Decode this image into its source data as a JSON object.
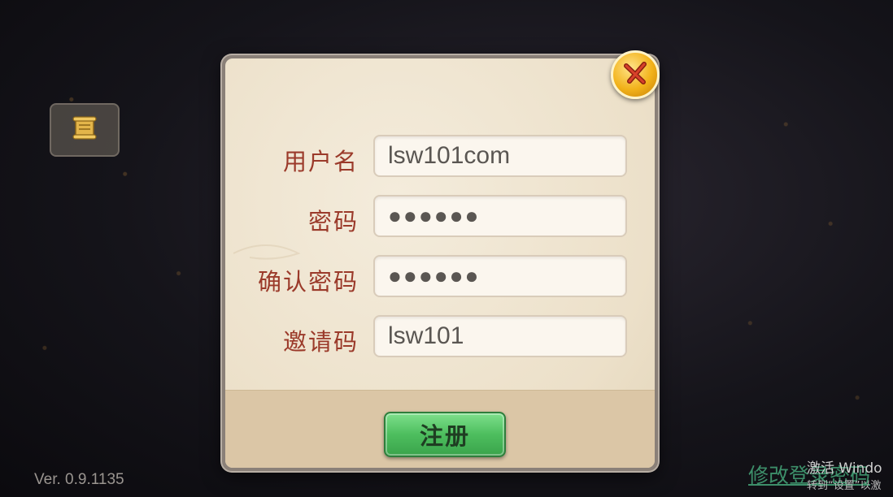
{
  "version_text": "Ver. 0.9.1135",
  "modify_link_text": "修改登录密码",
  "watermark": {
    "line1": "激活 Windo",
    "line2": "转到“设置”以激"
  },
  "form": {
    "fields": [
      {
        "label": "用户名",
        "value": "lsw101com",
        "type": "text"
      },
      {
        "label": "密码",
        "value": "●●●●●●",
        "type": "password"
      },
      {
        "label": "确认密码",
        "value": "●●●●●●",
        "type": "password"
      },
      {
        "label": "邀请码",
        "value": "lsw101",
        "type": "text"
      }
    ]
  },
  "register_button_label": "注册",
  "icons": {
    "close": "close-icon",
    "scroll": "scroll-icon"
  },
  "colors": {
    "label": "#9b3a2a",
    "panel": "#ece0c9",
    "button_green": "#4dbe5e",
    "close_gold": "#f2b21a"
  }
}
